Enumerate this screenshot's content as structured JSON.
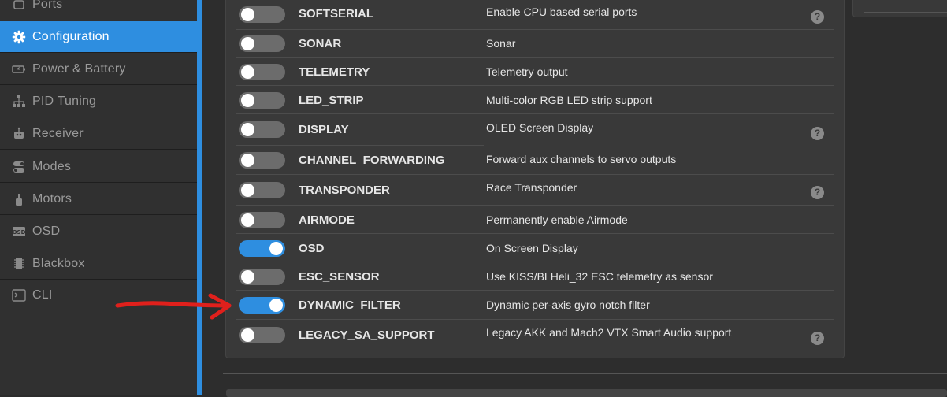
{
  "sidebar": {
    "items": [
      {
        "label": "Ports",
        "icon": "ports-icon"
      },
      {
        "label": "Configuration",
        "icon": "gear-icon",
        "active": true
      },
      {
        "label": "Power & Battery",
        "icon": "battery-icon"
      },
      {
        "label": "PID Tuning",
        "icon": "pid-tree-icon"
      },
      {
        "label": "Receiver",
        "icon": "receiver-robot-icon"
      },
      {
        "label": "Modes",
        "icon": "modes-switch-icon"
      },
      {
        "label": "Motors",
        "icon": "motor-icon"
      },
      {
        "label": "OSD",
        "icon": "osd-icon"
      },
      {
        "label": "Blackbox",
        "icon": "blackbox-chip-icon"
      },
      {
        "label": "CLI",
        "icon": "terminal-icon"
      }
    ]
  },
  "features": [
    {
      "name": "SOFTSERIAL",
      "description": "Enable CPU based serial ports",
      "enabled": false,
      "help": true
    },
    {
      "name": "SONAR",
      "description": "Sonar",
      "enabled": false,
      "help": false
    },
    {
      "name": "TELEMETRY",
      "description": "Telemetry output",
      "enabled": false,
      "help": false
    },
    {
      "name": "LED_STRIP",
      "description": "Multi-color RGB LED strip support",
      "enabled": false,
      "help": false
    },
    {
      "name": "DISPLAY",
      "description": "OLED Screen Display",
      "enabled": false,
      "help": true
    },
    {
      "name": "CHANNEL_FORWARDING",
      "description": "Forward aux channels to servo outputs",
      "enabled": false,
      "help": false
    },
    {
      "name": "TRANSPONDER",
      "description": "Race Transponder",
      "enabled": false,
      "help": true
    },
    {
      "name": "AIRMODE",
      "description": "Permanently enable Airmode",
      "enabled": false,
      "help": false
    },
    {
      "name": "OSD",
      "description": "On Screen Display",
      "enabled": true,
      "help": false
    },
    {
      "name": "ESC_SENSOR",
      "description": "Use KISS/BLHeli_32 ESC telemetry as sensor",
      "enabled": false,
      "help": false
    },
    {
      "name": "DYNAMIC_FILTER",
      "description": "Dynamic per-axis gyro notch filter",
      "enabled": true,
      "help": false
    },
    {
      "name": "LEGACY_SA_SUPPORT",
      "description": "Legacy AKK and Mach2 VTX Smart Audio support",
      "enabled": false,
      "help": true
    }
  ],
  "help_symbol": "?",
  "annotation": {
    "type": "red-arrow",
    "points_to": "DYNAMIC_FILTER",
    "color": "#e0201c"
  },
  "colors": {
    "accent": "#2e8ee0",
    "toggle_off": "#6c6c6c",
    "panel": "#393939",
    "sidebar": "#303030"
  }
}
